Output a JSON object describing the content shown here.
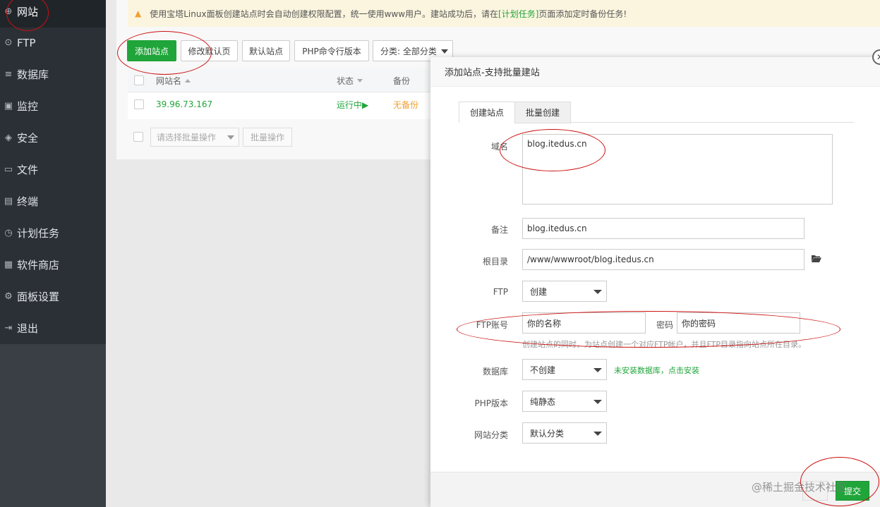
{
  "sidebar": {
    "items": [
      {
        "label": "网站",
        "icon": "globe-icon",
        "glyph": "⊕"
      },
      {
        "label": "FTP",
        "icon": "ftp-icon",
        "glyph": "⊙"
      },
      {
        "label": "数据库",
        "icon": "database-icon",
        "glyph": "≡"
      },
      {
        "label": "监控",
        "icon": "monitor-icon",
        "glyph": "▣"
      },
      {
        "label": "安全",
        "icon": "shield-icon",
        "glyph": "◈"
      },
      {
        "label": "文件",
        "icon": "folder-icon",
        "glyph": "▭"
      },
      {
        "label": "终端",
        "icon": "terminal-icon",
        "glyph": "▤"
      },
      {
        "label": "计划任务",
        "icon": "clock-icon",
        "glyph": "◷"
      },
      {
        "label": "软件商店",
        "icon": "grid-icon",
        "glyph": "▦"
      },
      {
        "label": "面板设置",
        "icon": "gear-icon",
        "glyph": "⚙"
      },
      {
        "label": "退出",
        "icon": "logout-icon",
        "glyph": "⇥"
      }
    ]
  },
  "notice": {
    "text_before": "使用宝塔Linux面板创建站点时会自动创建权限配置，统一使用www用户。建站成功后，请在",
    "link": "[计划任务]",
    "text_after": "页面添加定时备份任务!"
  },
  "toolbar": {
    "add_site": "添加站点",
    "modify_default": "修改默认页",
    "default_site": "默认站点",
    "php_cli": "PHP命令行版本",
    "category": "分类: 全部分类"
  },
  "table": {
    "headers": {
      "name": "网站名",
      "status": "状态",
      "backup": "备份"
    },
    "rows": [
      {
        "name": "39.96.73.167",
        "status": "运行中▶",
        "backup": "无备份"
      }
    ]
  },
  "batch": {
    "placeholder": "请选择批量操作",
    "button": "批量操作"
  },
  "modal": {
    "title": "添加站点-支持批量建站",
    "close": "✕",
    "tabs": [
      "创建站点",
      "批量创建"
    ],
    "domain_label": "域名",
    "domain_value": "blog.itedus.cn",
    "remark_label": "备注",
    "remark_value": "blog.itedus.cn",
    "root_label": "根目录",
    "root_value": "/www/wwwroot/blog.itedus.cn",
    "ftp_label": "FTP",
    "ftp_value": "创建",
    "ftp_account_label": "FTP账号",
    "ftp_account_value": "你的名称",
    "password_label": "密码",
    "password_value": "你的密码",
    "ftp_hint": "创建站点的同时，为站点创建一个对应FTP帐户，并且FTP目录指向站点所在目录。",
    "db_label": "数据库",
    "db_value": "不创建",
    "db_hint": "未安装数据库，点击安装",
    "php_label": "PHP版本",
    "php_value": "纯静态",
    "category_label": "网站分类",
    "category_value": "默认分类",
    "submit": "提交"
  },
  "watermark": "@稀土掘金技术社区",
  "colors": {
    "accent": "#20a53a",
    "annotation": "#cc1010",
    "warning": "#f0a030"
  }
}
